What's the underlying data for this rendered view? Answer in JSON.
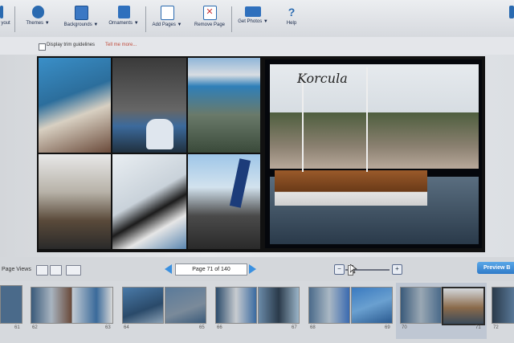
{
  "toolbar": {
    "layout_label": "yout",
    "themes_label": "Themes ▼",
    "backgrounds_label": "Backgrounds ▼",
    "ornaments_label": "Ornaments ▼",
    "add_pages_label": "Add Pages ▼",
    "remove_page_label": "Remove Page",
    "get_photos_label": "Get Photos ▼",
    "help_label": "Help"
  },
  "options": {
    "trim_label": "Display trim guidelines",
    "tell_me_more": "Tell me more..."
  },
  "spread": {
    "caption": "Korcula"
  },
  "bottom": {
    "page_views_label": "Page Views",
    "page_indicator": "Page 71 of 140",
    "preview_label": "Preview B"
  },
  "thumbnails": [
    {
      "num": "61"
    },
    {
      "num": "62"
    },
    {
      "num": "63"
    },
    {
      "num": "64"
    },
    {
      "num": "65"
    },
    {
      "num": "66"
    },
    {
      "num": "67"
    },
    {
      "num": "68"
    },
    {
      "num": "69"
    },
    {
      "num": "70"
    },
    {
      "num": "71"
    },
    {
      "num": "72"
    }
  ],
  "colors": {
    "accent": "#2f7ac8",
    "link": "#c04a3a",
    "toolbar_text": "#1a2a4a"
  }
}
